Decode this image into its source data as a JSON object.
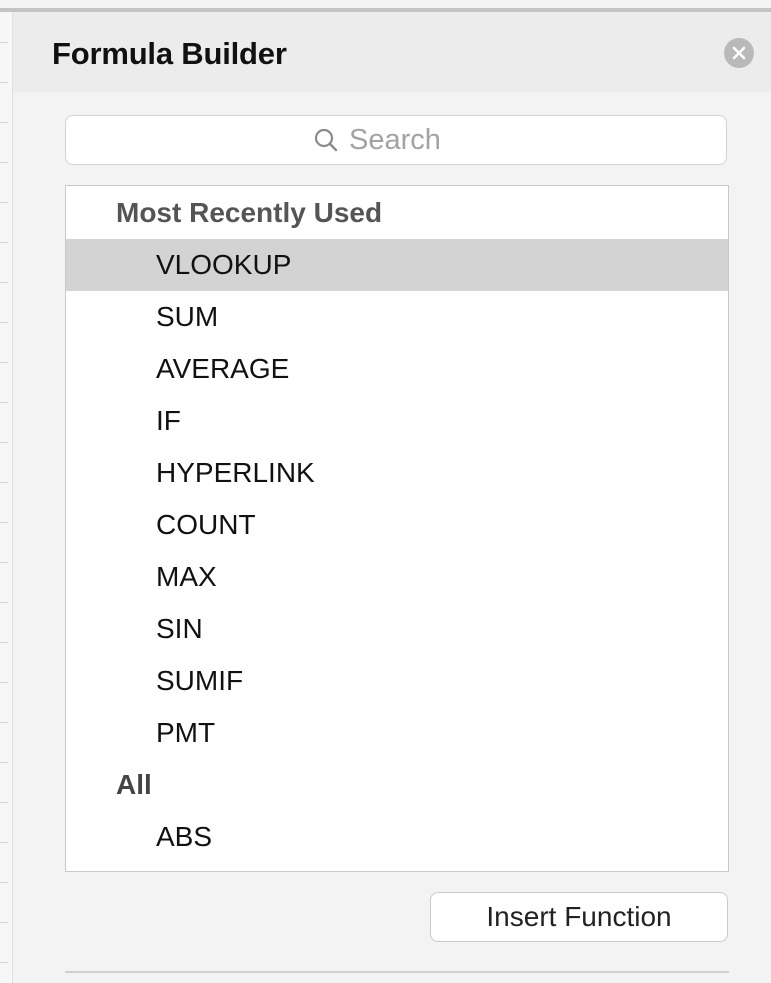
{
  "header": {
    "title": "Formula Builder"
  },
  "search": {
    "placeholder": "Search",
    "value": ""
  },
  "list": {
    "groups": [
      {
        "label": "Most Recently Used",
        "items": [
          "VLOOKUP",
          "SUM",
          "AVERAGE",
          "IF",
          "HYPERLINK",
          "COUNT",
          "MAX",
          "SIN",
          "SUMIF",
          "PMT"
        ]
      },
      {
        "label": "All",
        "items": [
          "ABS"
        ]
      }
    ],
    "selected": "VLOOKUP"
  },
  "footer": {
    "insert_label": "Insert Function"
  },
  "icons": {
    "close": "close-icon",
    "search": "search-icon"
  },
  "colors": {
    "selection": "#d3d3d3",
    "close_button": "#b9b9b9"
  }
}
